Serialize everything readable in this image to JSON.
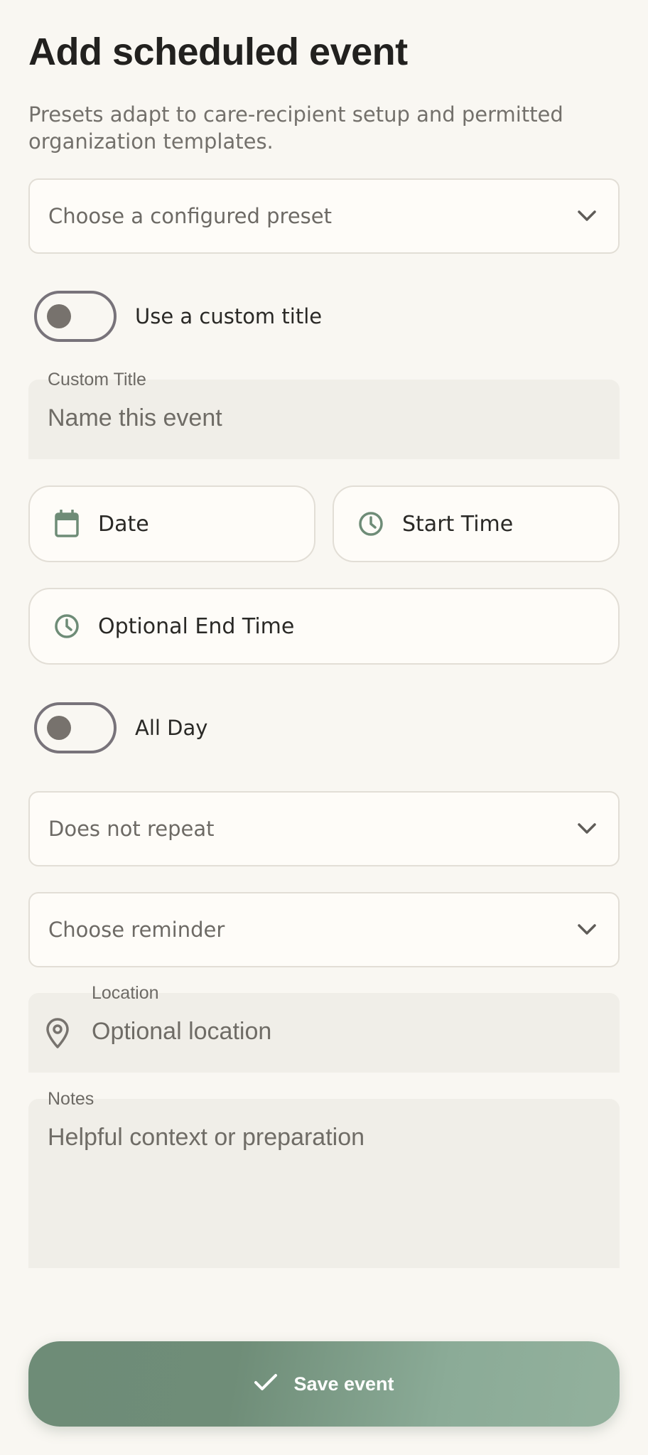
{
  "header": {
    "title": "Add scheduled event",
    "subtitle": "Presets adapt to care-recipient setup and permitted organization templates."
  },
  "preset": {
    "placeholder": "Choose a configured preset",
    "icon": "chevron-down-icon"
  },
  "custom_title_toggle": {
    "label": "Use a custom title",
    "on": false
  },
  "custom_title": {
    "label": "Custom Title",
    "placeholder": "Name this event"
  },
  "date": {
    "label": "Date",
    "icon": "calendar-icon"
  },
  "start_time": {
    "label": "Start Time",
    "icon": "clock-icon"
  },
  "end_time": {
    "label": "Optional End Time",
    "icon": "clock-icon"
  },
  "all_day_toggle": {
    "label": "All Day",
    "on": false
  },
  "repeat": {
    "placeholder": "Does not repeat",
    "icon": "chevron-down-icon"
  },
  "reminder": {
    "placeholder": "Choose reminder",
    "icon": "chevron-down-icon"
  },
  "location": {
    "label": "Location",
    "placeholder": "Optional location",
    "icon": "location-pin-icon"
  },
  "notes": {
    "label": "Notes",
    "placeholder": "Helpful context or preparation"
  },
  "save": {
    "label": "Save event",
    "icon": "check-icon"
  },
  "colors": {
    "accent": "#6e8c77",
    "background": "#f9f7f2",
    "field_fill": "#f0eee8",
    "border": "#e2ded6"
  }
}
